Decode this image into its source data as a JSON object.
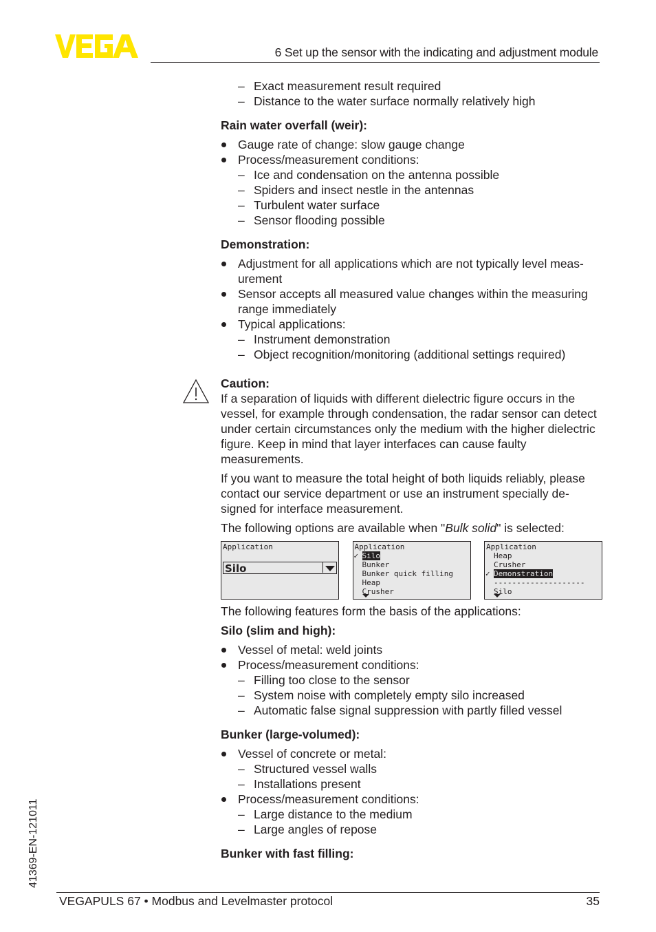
{
  "header": {
    "logo_text": "VEGA",
    "logo_color": "#ffe500",
    "section_title": "6 Set up the sensor with the indicating and adjustment module"
  },
  "side_code": "41369-EN-121011",
  "footer": {
    "product": "VEGAPULS 67 • Modbus and Levelmaster protocol",
    "page_number": "35"
  },
  "body": {
    "intro_dashes": [
      "Exact measurement result required",
      "Distance to the water surface normally relatively high"
    ],
    "rain_water": {
      "heading": "Rain water overfall (weir):",
      "bullet_1": "Gauge rate of change: slow gauge change",
      "bullet_2": "Process/measurement conditions:",
      "dashes": [
        "Ice and condensation on the antenna possible",
        "Spiders and insect nestle in the antennas",
        "Turbulent water surface",
        "Sensor flooding possible"
      ]
    },
    "demonstration": {
      "heading": "Demonstration:",
      "bullet_1": "Adjustment for all applications which are not typically level meas-urement",
      "bullet_2": "Sensor accepts all measured value changes within the measuring range immediately",
      "bullet_3": "Typical applications:",
      "dashes": [
        "Instrument demonstration",
        "Object recognition/monitoring (additional settings required)"
      ]
    },
    "caution": {
      "icon": "warning-triangle-icon",
      "heading": "Caution:",
      "text": "If a separation of liquids with different dielectric figure occurs in the vessel, for example through condensation, the radar sensor can detect under certain circumstances only the medium with the higher dielectric figure. Keep in mind that layer interfaces can cause faulty measurements.",
      "para_2": "If you want to measure the total height of both liquids reliably, please contact our service department or use an instrument specially de-signed for interface measurement.",
      "options_intro_pre": "The following options are available when \"",
      "options_intro_em": "Bulk solid",
      "options_intro_post": "\" is selected:"
    },
    "displays": {
      "d1": {
        "title": "Application",
        "selected": "Silo"
      },
      "d2": {
        "title": "Application",
        "items": [
          "Silo",
          "Bunker",
          "Bunker quick filling",
          "Heap",
          "Crusher"
        ],
        "checked": "Silo"
      },
      "d3": {
        "title": "Application",
        "items": [
          "Heap",
          "Crusher",
          "Demonstration",
          "--------------------",
          "Silo"
        ],
        "checked": "Demonstration"
      }
    },
    "features_intro": "The following features form the basis of the applications:",
    "silo": {
      "heading": "Silo (slim and high):",
      "bullet_1": "Vessel of metal: weld joints",
      "bullet_2": "Process/measurement conditions:",
      "dashes": [
        "Filling too close to the sensor",
        "System noise with completely empty silo increased",
        "Automatic false signal suppression with partly filled vessel"
      ]
    },
    "bunker": {
      "heading": "Bunker (large-volumed):",
      "bullet_1": "Vessel of concrete or metal:",
      "dashes_1": [
        "Structured vessel walls",
        "Installations present"
      ],
      "bullet_2": "Process/measurement conditions:",
      "dashes_2": [
        "Large distance to the medium",
        "Large angles of repose"
      ]
    },
    "bunker_fast": {
      "heading": "Bunker with fast filling:"
    }
  }
}
